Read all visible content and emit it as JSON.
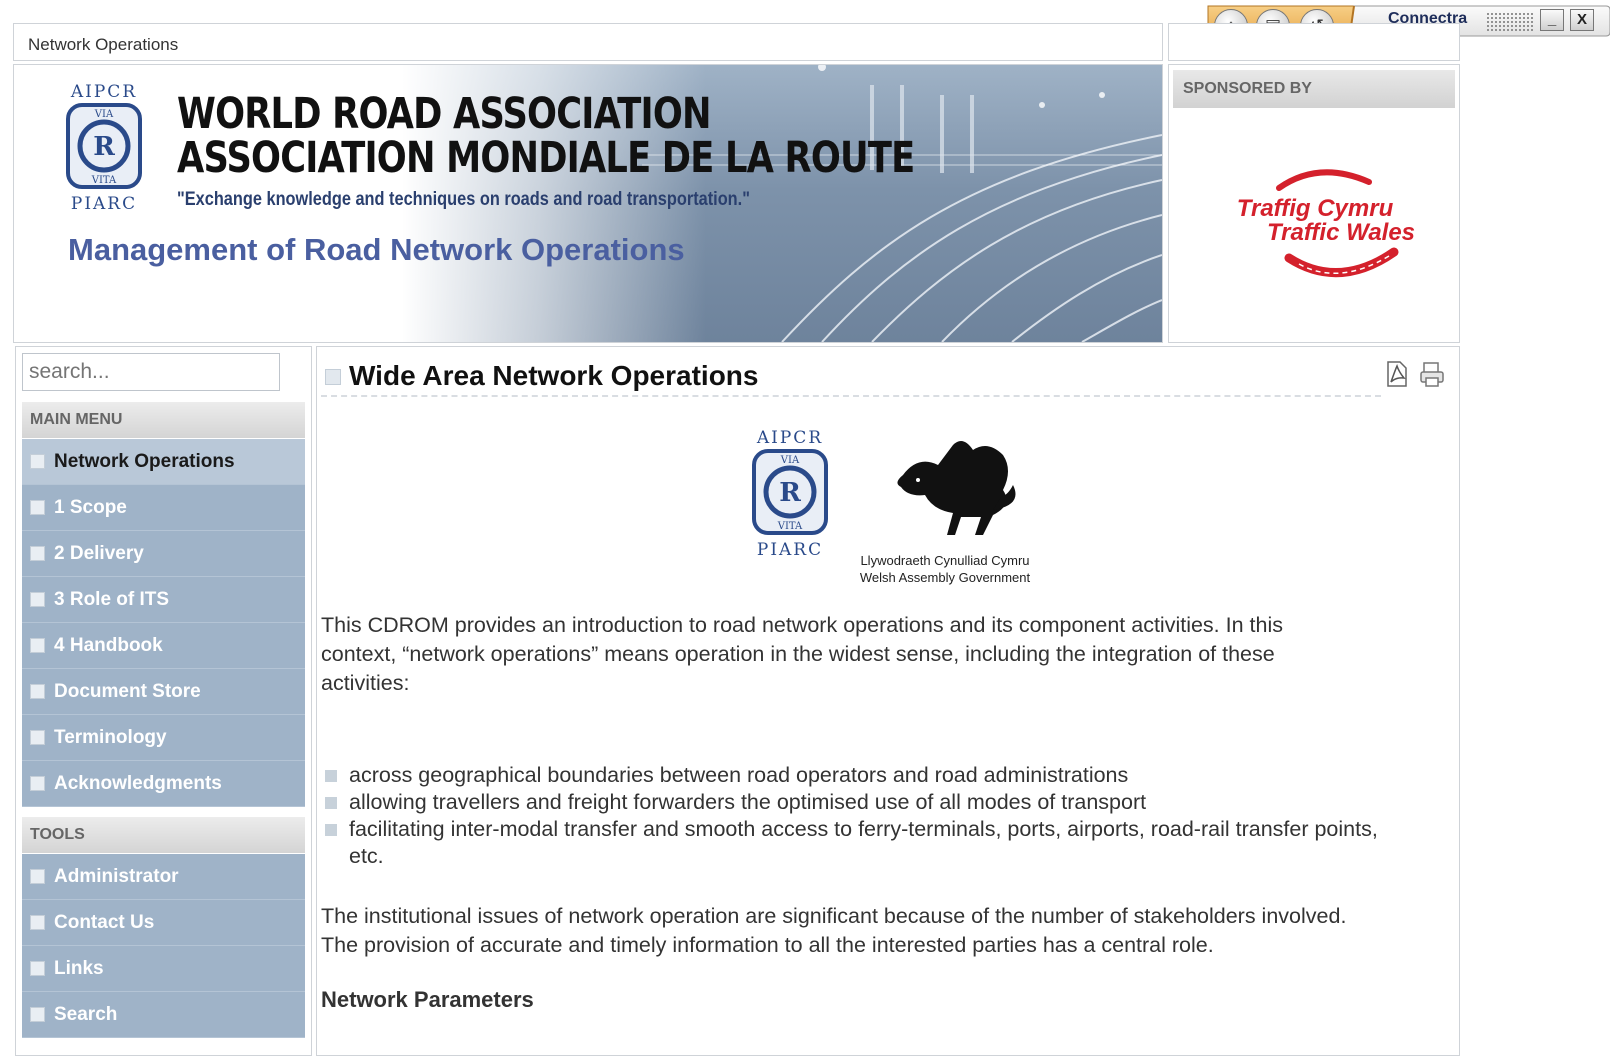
{
  "breadcrumb": "Network Operations",
  "header": {
    "logo_top": "AIPCR",
    "logo_bottom": "PIARC",
    "logo_via": "VIA",
    "logo_vita": "VITA",
    "title_en": "WORLD ROAD ASSOCIATION",
    "title_fr": "ASSOCIATION MONDIALE DE LA ROUTE",
    "tagline": "\"Exchange knowledge and techniques on roads and road transportation.\"",
    "site_title": "Management of Road Network Operations"
  },
  "sponsor": {
    "heading": "SPONSORED BY",
    "line1": "Traffig Cymru",
    "line2": "Traffic Wales"
  },
  "toolbar": {
    "brand": "Connectra",
    "minimize": "_",
    "close": "X",
    "icons": [
      "home-icon",
      "bookmark-icon",
      "back-icon"
    ]
  },
  "sidebar": {
    "search_placeholder": "search...",
    "main_menu_heading": "MAIN MENU",
    "main_menu": [
      {
        "label": "Network Operations",
        "active": true
      },
      {
        "label": "1 Scope"
      },
      {
        "label": "2 Delivery"
      },
      {
        "label": "3 Role of ITS"
      },
      {
        "label": "4 Handbook"
      },
      {
        "label": "Document Store"
      },
      {
        "label": "Terminology"
      },
      {
        "label": "Acknowledgments"
      }
    ],
    "tools_heading": "TOOLS",
    "tools": [
      {
        "label": "Administrator"
      },
      {
        "label": "Contact Us"
      },
      {
        "label": "Links"
      },
      {
        "label": "Search"
      }
    ]
  },
  "main": {
    "title": "Wide Area Network Operations",
    "partner_wag_line1": "Llywodraeth Cynulliad Cymru",
    "partner_wag_line2": "Welsh Assembly Government",
    "intro_line1": "This CDROM provides an introduction to road network operations and its component activities. In this",
    "intro_line2": "context, “network operations” means operation in the widest sense, including the integration of these",
    "intro_line3": "activities:",
    "bullets": [
      "across geographical boundaries between road operators and road administrations",
      "allowing travellers and freight forwarders the optimised use of all modes of transport",
      "facilitating inter-modal transfer and smooth access to ferry-terminals, ports, airports, road-rail transfer points, etc."
    ],
    "para2_line1": "The institutional issues of network operation are significant because of the number of stakeholders involved.",
    "para2_line2": "The provision of accurate and timely information to all the interested parties has a central role.",
    "subheading": "Network Parameters"
  },
  "colors": {
    "menu_bg": "#9fb3c8",
    "menu_active_bg": "#b9c8d8",
    "site_title": "#4a5fa0",
    "sponsor_red": "#d4212c",
    "toolbar_orange": "#f1b356"
  }
}
